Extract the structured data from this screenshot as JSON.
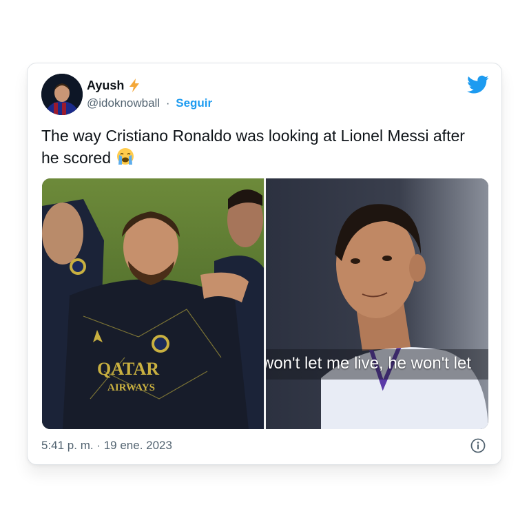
{
  "tweet": {
    "author_name": "Ayush",
    "author_badge_icon": "lightning-bolt",
    "handle": "@idoknowball",
    "separator": "·",
    "follow_label": "Seguir",
    "text": "The way Cristiano Ronaldo was looking at Lionel Messi after he scored",
    "emoji": "loudly-crying-face",
    "timestamp": "5:41 p. m. · 19 ene. 2023",
    "video_caption": "won't let me live, he won't let",
    "jersey_text": {
      "sponsor_line1": "QATAR",
      "sponsor_line2": "AIRWAYS"
    }
  },
  "colors": {
    "accent": "#1d9bf0",
    "text_primary": "#0f1419",
    "text_secondary": "#536471",
    "bolt": "#f4a83a"
  }
}
